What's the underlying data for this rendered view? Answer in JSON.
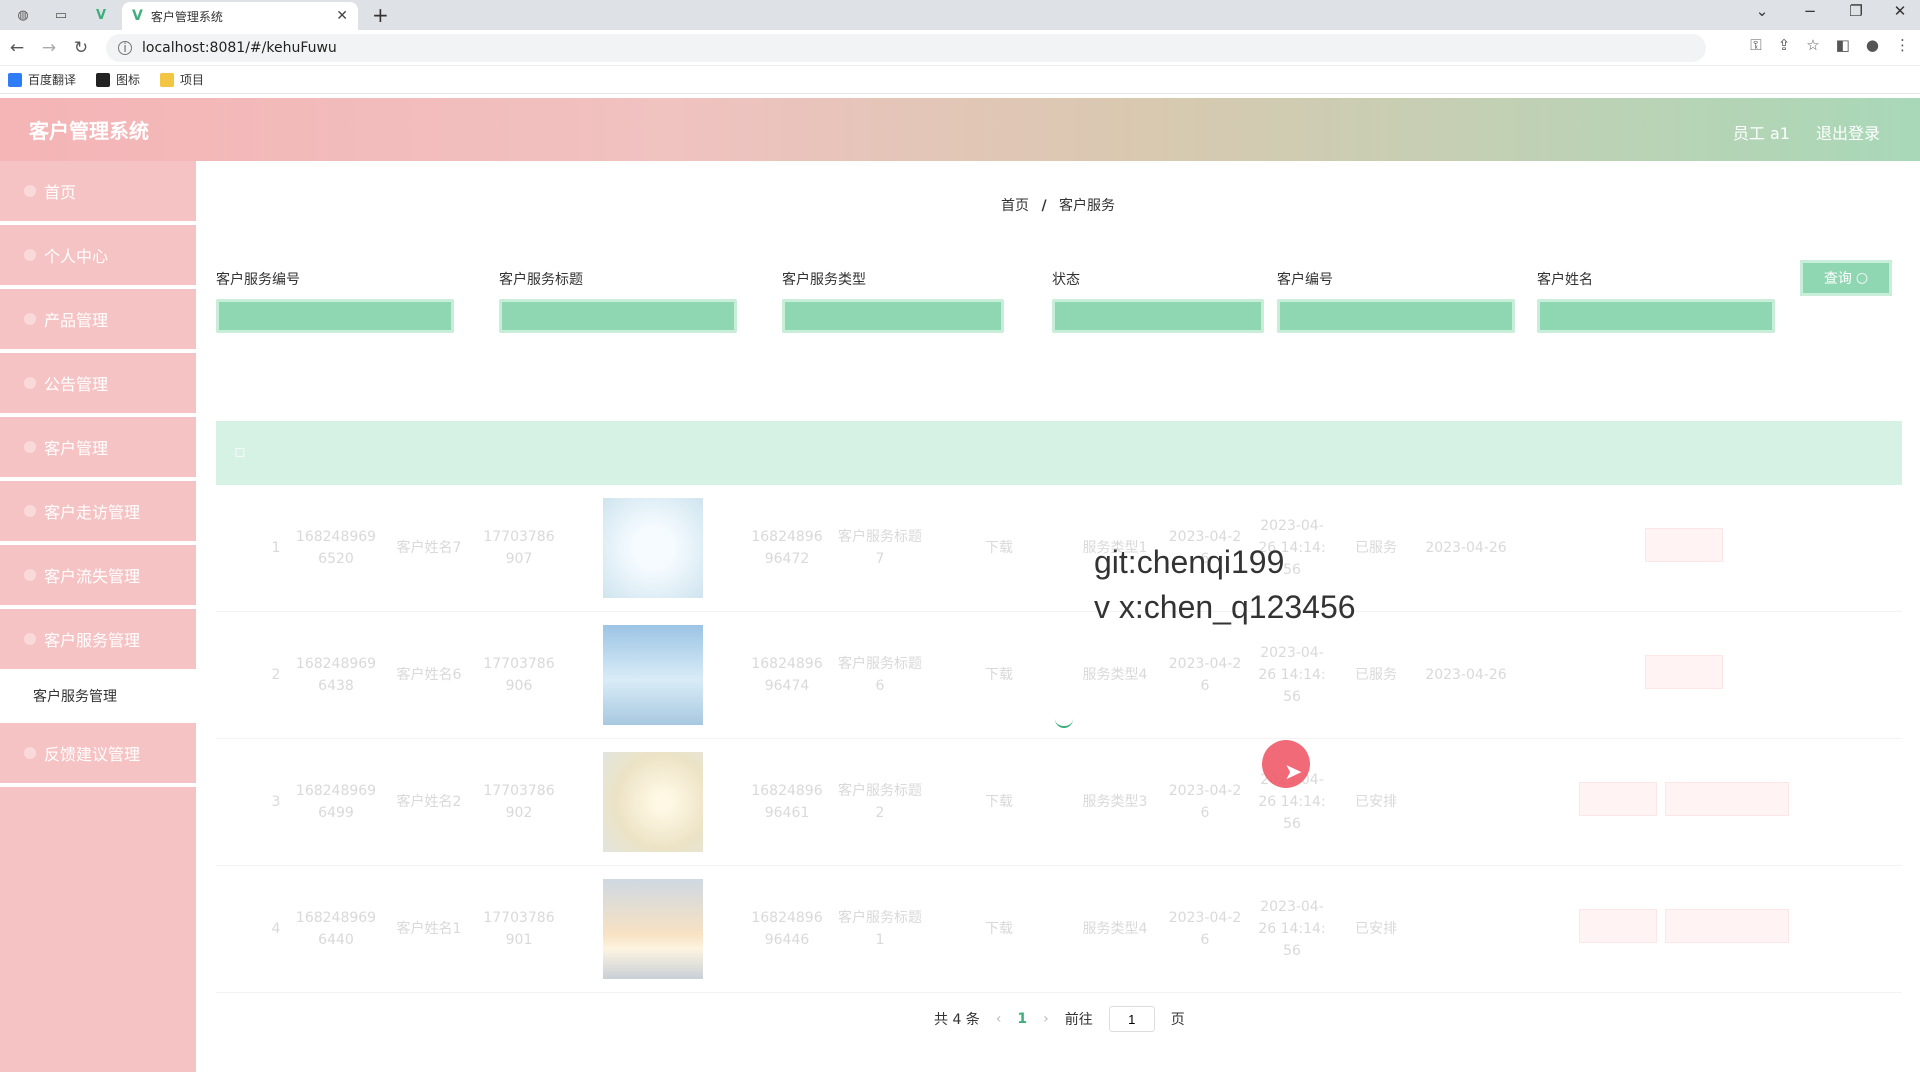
{
  "browser": {
    "tab_title": "客户管理系统",
    "url": "localhost:8081/#/kehuFuwu",
    "bookmarks": [
      "百度翻译",
      "图标",
      "项目"
    ]
  },
  "app": {
    "title": "客户管理系统",
    "user_label": "员工 a1",
    "logout_label": "退出登录"
  },
  "sidebar": {
    "items": [
      {
        "label": "首页"
      },
      {
        "label": "个人中心"
      },
      {
        "label": "产品管理"
      },
      {
        "label": "公告管理"
      },
      {
        "label": "客户管理"
      },
      {
        "label": "客户走访管理"
      },
      {
        "label": "客户流失管理"
      },
      {
        "label": "客户服务管理"
      }
    ],
    "sub_item": "客户服务管理",
    "last_item": "反馈建议管理"
  },
  "breadcrumb": {
    "home": "首页",
    "sep": "/",
    "current": "客户服务"
  },
  "filters": [
    {
      "label": "客户服务编号"
    },
    {
      "label": "客户服务标题"
    },
    {
      "label": "客户服务类型"
    },
    {
      "label": "状态"
    },
    {
      "label": "客户编号"
    },
    {
      "label": "客户姓名"
    }
  ],
  "query_button": "查询",
  "table": {
    "rows": [
      {
        "index": "1",
        "c1": "1682489696520",
        "c2": "客户姓名7",
        "c3": "17703786907",
        "c5": "1682489696472",
        "c6": "客户服务标题7",
        "c7": "下载",
        "c8": "服务类型1",
        "c9": "2023-04-26",
        "c10": "2023-04-26 14:14:56",
        "c11": "已服务",
        "c12": "2023-04-26"
      },
      {
        "index": "2",
        "c1": "1682489696438",
        "c2": "客户姓名6",
        "c3": "17703786906",
        "c5": "1682489696474",
        "c6": "客户服务标题6",
        "c7": "下载",
        "c8": "服务类型4",
        "c9": "2023-04-26",
        "c10": "2023-04-26 14:14:56",
        "c11": "已服务",
        "c12": "2023-04-26"
      },
      {
        "index": "3",
        "c1": "1682489696499",
        "c2": "客户姓名2",
        "c3": "17703786902",
        "c5": "1682489696461",
        "c6": "客户服务标题2",
        "c7": "下载",
        "c8": "服务类型3",
        "c9": "2023-04-26",
        "c10": "2023-04-26 14:14:56",
        "c11": "已安排",
        "c12": ""
      },
      {
        "index": "4",
        "c1": "1682489696440",
        "c2": "客户姓名1",
        "c3": "17703786901",
        "c5": "1682489696446",
        "c6": "客户服务标题1",
        "c7": "下载",
        "c8": "服务类型4",
        "c9": "2023-04-26",
        "c10": "2023-04-26 14:14:56",
        "c11": "已安排",
        "c12": ""
      }
    ]
  },
  "overlay": {
    "line1": "git:chenqi199",
    "line2": "v x:chen_q123456"
  },
  "pagination": {
    "total": "共 4 条",
    "current": "1",
    "goto_label": "前往",
    "goto_value": "1",
    "page_suffix": "页"
  },
  "colors": {
    "header_start": "#f5b4b6",
    "header_end": "#a8d8b8",
    "sidebar": "#f6c3c4",
    "accent": "#8fd6b3"
  }
}
